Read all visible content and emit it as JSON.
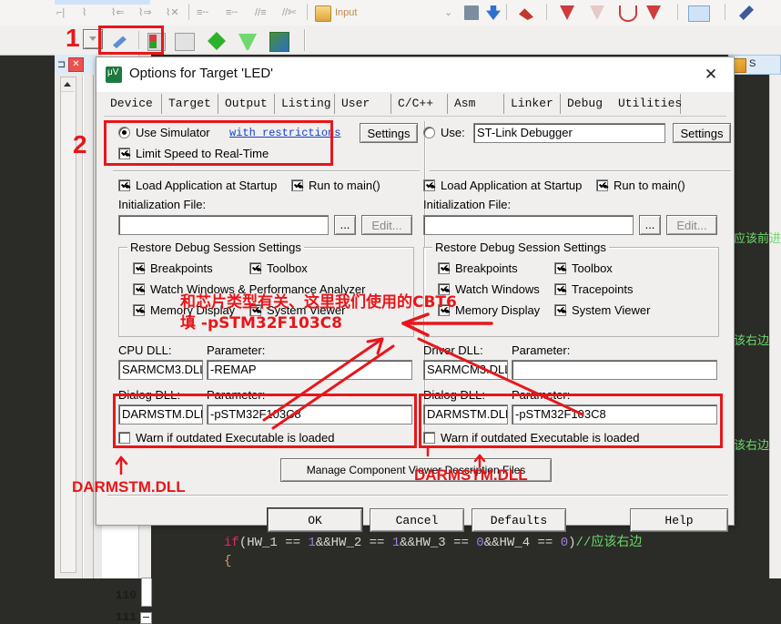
{
  "dialog": {
    "title": "Options for Target 'LED'",
    "close_label": "✕",
    "tabs": [
      {
        "label": "Device",
        "active": false
      },
      {
        "label": "Target",
        "active": false
      },
      {
        "label": "Output",
        "active": false
      },
      {
        "label": "Listing",
        "active": false
      },
      {
        "label": "User",
        "active": false
      },
      {
        "label": "C/C++",
        "active": false
      },
      {
        "label": "Asm",
        "active": false
      },
      {
        "label": "Linker",
        "active": false
      },
      {
        "label": "Debug",
        "active": true
      },
      {
        "label": "Utilities",
        "active": false
      }
    ],
    "left": {
      "use_simulator_label": "Use Simulator",
      "with_restrictions_label": "with restrictions",
      "settings_label": "Settings",
      "limit_speed_label": "Limit Speed to Real-Time",
      "load_app_label": "Load Application at Startup",
      "run_to_main_label": "Run to main()",
      "init_file_label": "Initialization File:",
      "init_file_value": "",
      "browse_label": "...",
      "edit_label": "Edit...",
      "restore_group_label": "Restore Debug Session Settings",
      "restore_items": [
        {
          "label": "Breakpoints",
          "checked": true
        },
        {
          "label": "Toolbox",
          "checked": true
        },
        {
          "label": "Watch Windows & Performance Analyzer",
          "checked": true
        },
        {
          "label": "Memory Display",
          "checked": true
        },
        {
          "label": "System Viewer",
          "checked": true
        }
      ],
      "cpu_dll_label": "CPU DLL:",
      "cpu_dll_value": "SARMCM3.DLL",
      "cpu_param_label": "Parameter:",
      "cpu_param_value": "-REMAP",
      "dialog_dll_label": "Dialog DLL:",
      "dialog_dll_value": "DARMSTM.DLL",
      "dialog_param_label": "Parameter:",
      "dialog_param_value": "-pSTM32F103C8",
      "warn_outdated_label": "Warn if outdated Executable is loaded"
    },
    "right": {
      "use_label": "Use:",
      "debugger_value": "ST-Link Debugger",
      "settings_label": "Settings",
      "load_app_label": "Load Application at Startup",
      "run_to_main_label": "Run to main()",
      "init_file_label": "Initialization File:",
      "init_file_value": "",
      "browse_label": "...",
      "edit_label": "Edit...",
      "restore_group_label": "Restore Debug Session Settings",
      "restore_items": [
        {
          "label": "Breakpoints",
          "checked": true
        },
        {
          "label": "Toolbox",
          "checked": true
        },
        {
          "label": "Watch Windows",
          "checked": true
        },
        {
          "label": "Tracepoints",
          "checked": true
        },
        {
          "label": "Memory Display",
          "checked": true
        },
        {
          "label": "System Viewer",
          "checked": true
        }
      ],
      "driver_dll_label": "Driver DLL:",
      "driver_dll_value": "SARMCM3.DLL",
      "driver_param_label": "Parameter:",
      "driver_param_value": "",
      "dialog_dll_label": "Dialog DLL:",
      "dialog_dll_value": "DARMSTM.DLL",
      "dialog_param_label": "Parameter:",
      "dialog_param_value": "-pSTM32F103C8",
      "warn_outdated_label": "Warn if outdated Executable is loaded"
    },
    "manage_button_label": "Manage Component Viewer Description Files",
    "footer": {
      "ok_label": "OK",
      "cancel_label": "Cancel",
      "defaults_label": "Defaults",
      "help_label": "Help"
    }
  },
  "annotations": {
    "step1": "1",
    "step2": "2",
    "note_line1": "和芯片类型有关、这里我们使用的CBT6",
    "note_line2": "填 -pSTM32F103C8",
    "dll_left": "DARMSTM.DLL",
    "dll_right": "DARMSTM.DLL",
    "color": "#e8161a"
  },
  "editor": {
    "tab_label": "S",
    "line_numbers": [
      "110",
      "111"
    ],
    "lines": [
      {
        "tokens": [
          {
            "t": "if",
            "c": "cc-key"
          },
          {
            "t": "(HW_1 == ",
            "c": "cc-plain"
          },
          {
            "t": "1",
            "c": "cc-num"
          },
          {
            "t": "&&HW_2 == ",
            "c": "cc-plain"
          },
          {
            "t": "1",
            "c": "cc-num"
          },
          {
            "t": "&&HW_3 == ",
            "c": "cc-plain"
          },
          {
            "t": "0",
            "c": "cc-num"
          },
          {
            "t": "&&HW_4 == ",
            "c": "cc-plain"
          },
          {
            "t": "0",
            "c": "cc-num"
          },
          {
            "t": ")",
            "c": "cc-plain"
          },
          {
            "t": "//应该右边",
            "c": "cc-cmt"
          }
        ]
      },
      {
        "tokens": [
          {
            "t": "{",
            "c": "cc-brace"
          }
        ]
      }
    ],
    "edge_comments": [
      "应该前进",
      "该右边",
      "该右边"
    ]
  },
  "toolbar": {
    "input_label": "Input",
    "icons_row2": [
      "dropdown-icon",
      "debug-wizard-icon",
      "target-options-icon",
      "manage-batch-icon",
      "green-diamond-icon",
      "green-funnel-icon",
      "package-installer-icon"
    ],
    "icons_row1": [
      "indent-icon",
      "outdent-icon",
      "bookmark-prev-icon",
      "bookmark-next-icon",
      "bookmark-clear-icon",
      "comment-icon",
      "uncomment-icon",
      "folder-icon"
    ]
  }
}
